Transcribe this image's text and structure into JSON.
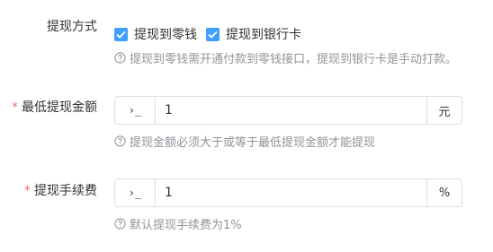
{
  "withdraw_method": {
    "label": "提现方式",
    "options": [
      {
        "label": "提现到零钱",
        "checked": true
      },
      {
        "label": "提现到银行卡",
        "checked": true
      }
    ],
    "tip": "提现到零钱需开通付款到零钱接口，提现到银行卡是手动打款。"
  },
  "min_amount": {
    "required_mark": "*",
    "label": "最低提现金额",
    "prepend": "›_",
    "value": "1",
    "append": "元",
    "tip": "提现金额必须大于或等于最低提现金额才能提现"
  },
  "fee": {
    "required_mark": "*",
    "label": "提现手续费",
    "prepend": "›_",
    "value": "1",
    "append": "%",
    "tip": "默认提现手续费为1%"
  },
  "colors": {
    "accent": "#409eff",
    "required": "#f56c6c",
    "tip": "#909399",
    "border": "#dcdfe6"
  }
}
